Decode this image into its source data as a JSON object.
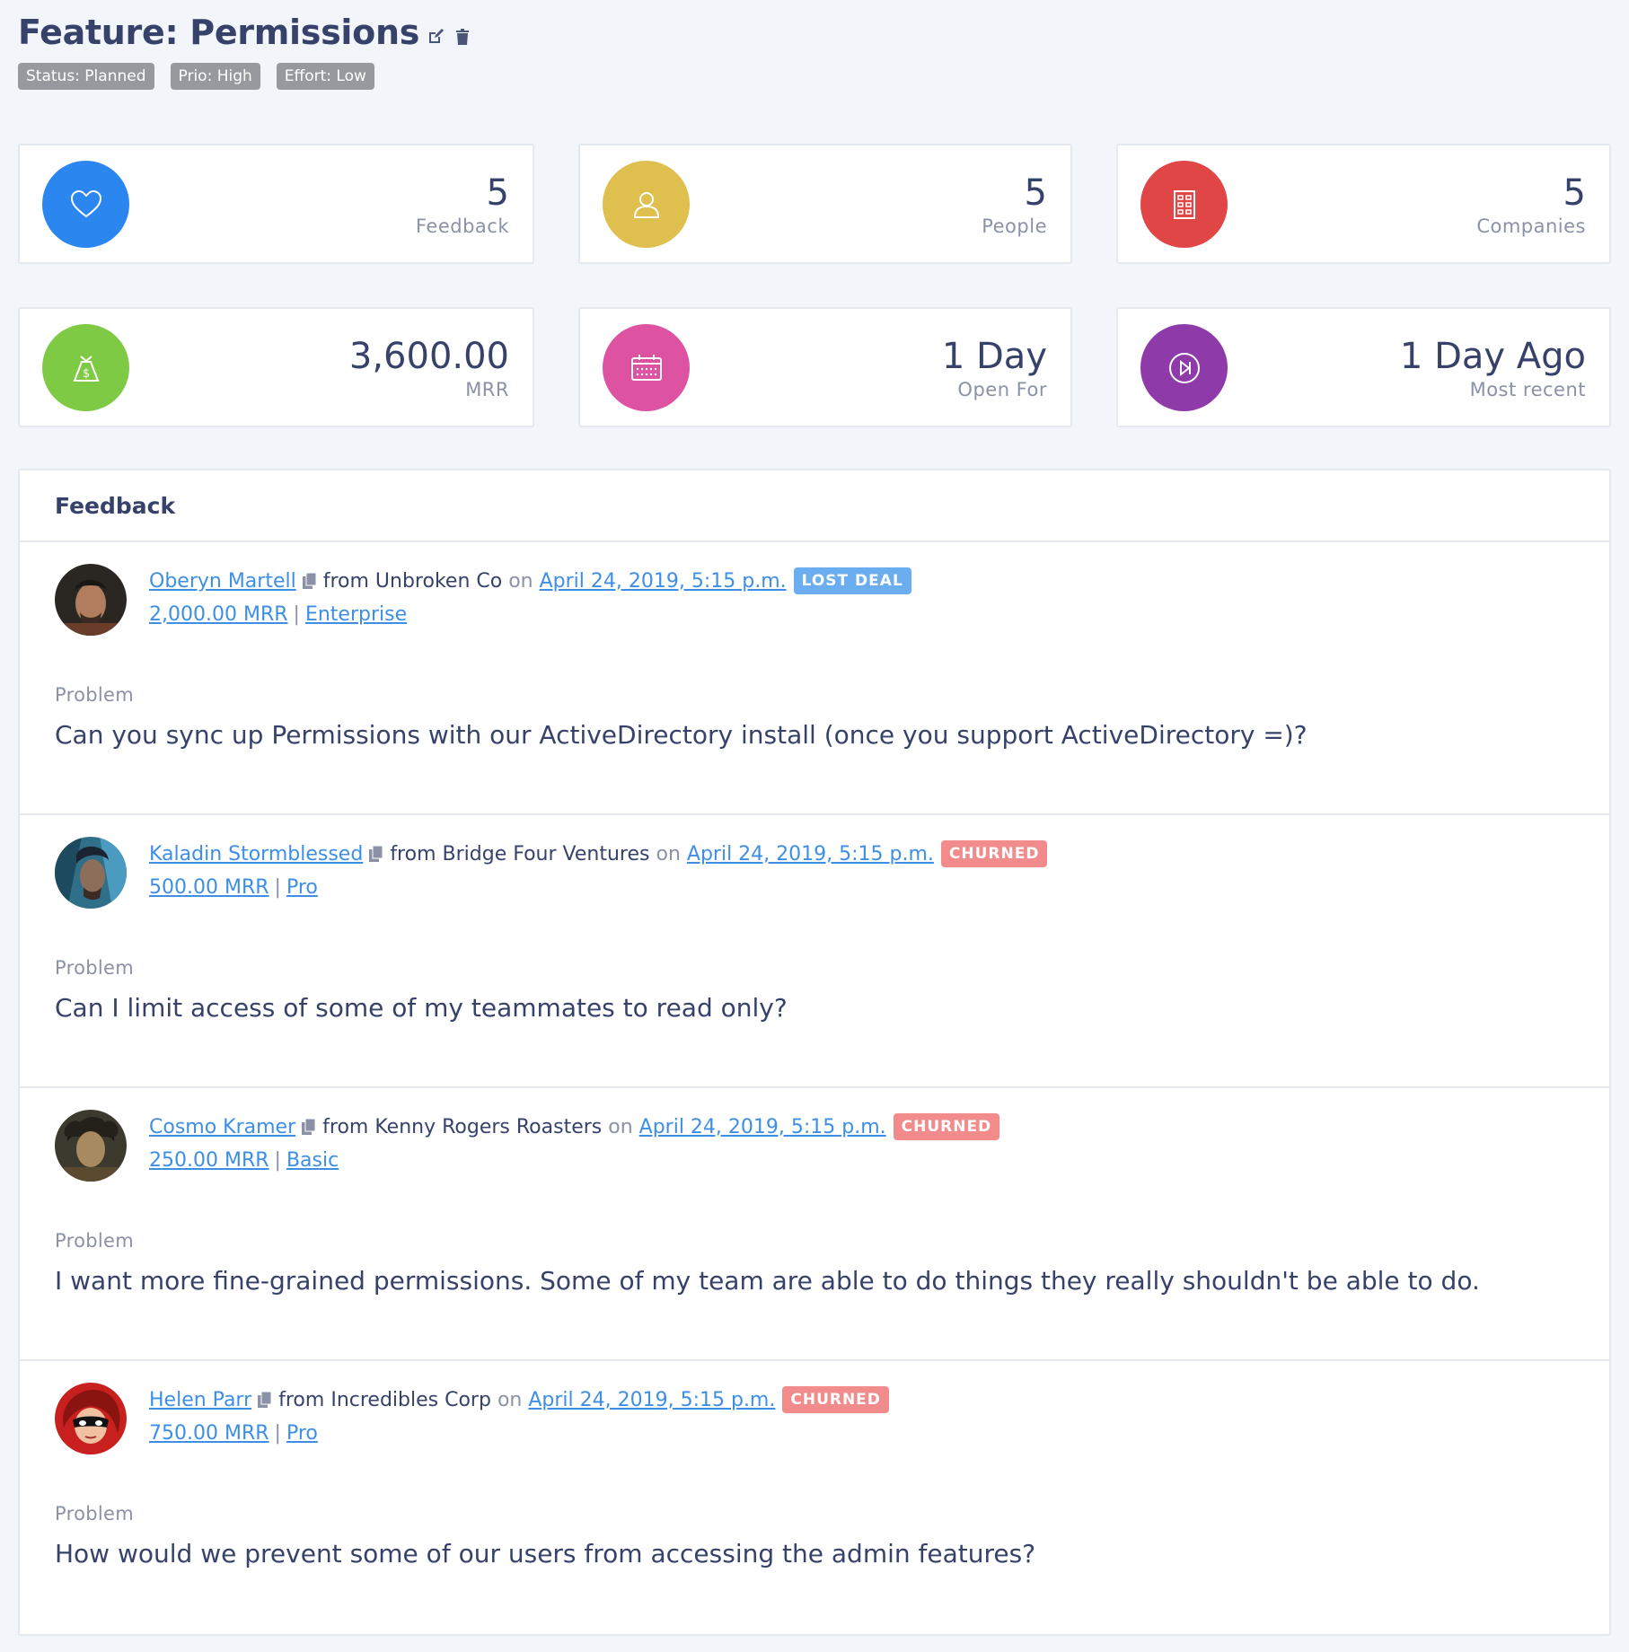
{
  "header": {
    "title": "Feature: Permissions",
    "badges": [
      "Status: Planned",
      "Prio: High",
      "Effort: Low"
    ]
  },
  "stats": [
    {
      "value": "5",
      "label": "Feedback",
      "color": "#2b86f0",
      "icon": "heart-icon"
    },
    {
      "value": "5",
      "label": "People",
      "color": "#dfbf4e",
      "icon": "user-icon"
    },
    {
      "value": "5",
      "label": "Companies",
      "color": "#e14646",
      "icon": "building-icon"
    },
    {
      "value": "3,600.00",
      "label": "MRR",
      "color": "#7fca45",
      "icon": "money-bag-icon"
    },
    {
      "value": "1 Day",
      "label": "Open For",
      "color": "#dd53a2",
      "icon": "calendar-icon"
    },
    {
      "value": "1 Day Ago",
      "label": "Most recent",
      "color": "#8e3aa9",
      "icon": "play-icon"
    }
  ],
  "feedback": {
    "title": "Feedback",
    "entries": [
      {
        "name": "Oberyn Martell",
        "from": "from",
        "company": "Unbroken Co",
        "on": "on",
        "date": "April 24, 2019, 5:15 p.m.",
        "status": "LOST DEAL",
        "status_color": "#6aaef0",
        "mrr": "2,000.00 MRR",
        "plan": "Enterprise",
        "problem_label": "Problem",
        "problem": "Can you sync up Permissions with our ActiveDirectory install (once you support ActiveDirectory =)?"
      },
      {
        "name": "Kaladin Stormblessed",
        "from": "from",
        "company": "Bridge Four Ventures",
        "on": "on",
        "date": "April 24, 2019, 5:15 p.m.",
        "status": "CHURNED",
        "status_color": "#f28c8c",
        "mrr": "500.00 MRR",
        "plan": "Pro",
        "problem_label": "Problem",
        "problem": "Can I limit access of some of my teammates to read only?"
      },
      {
        "name": "Cosmo Kramer",
        "from": "from",
        "company": "Kenny Rogers Roasters",
        "on": "on",
        "date": "April 24, 2019, 5:15 p.m.",
        "status": "CHURNED",
        "status_color": "#f28c8c",
        "mrr": "250.00 MRR",
        "plan": "Basic",
        "problem_label": "Problem",
        "problem": "I want more fine-grained permissions. Some of my team are able to do things they really shouldn't be able to do."
      },
      {
        "name": "Helen Parr",
        "from": "from",
        "company": "Incredibles Corp",
        "on": "on",
        "date": "April 24, 2019, 5:15 p.m.",
        "status": "CHURNED",
        "status_color": "#f28c8c",
        "mrr": "750.00 MRR",
        "plan": "Pro",
        "problem_label": "Problem",
        "problem": "How would we prevent some of our users from accessing the admin features?"
      }
    ]
  }
}
